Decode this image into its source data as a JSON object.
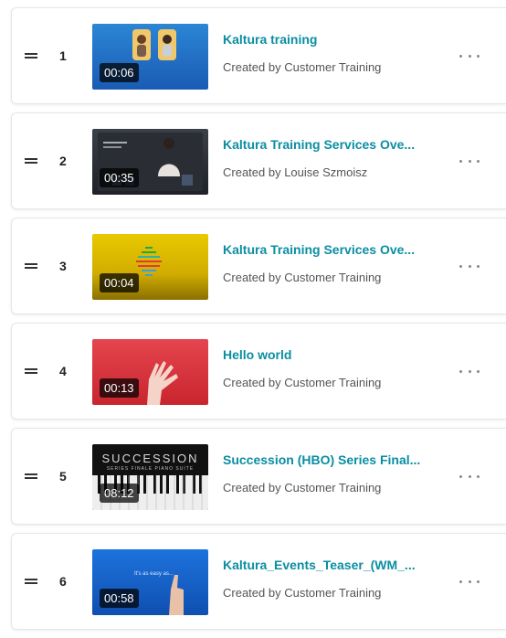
{
  "playlist": {
    "items": [
      {
        "index": "1",
        "duration": "00:06",
        "title": "Kaltura training",
        "creator": "Created by Customer Training"
      },
      {
        "index": "2",
        "duration": "00:35",
        "title": "Kaltura Training Services Ove...",
        "creator": "Created by Louise Szmoisz"
      },
      {
        "index": "3",
        "duration": "00:04",
        "title": "Kaltura Training Services Ove...",
        "creator": "Created by Customer Training"
      },
      {
        "index": "4",
        "duration": "00:13",
        "title": "Hello world",
        "creator": "Created by Customer Training"
      },
      {
        "index": "5",
        "duration": "08:12",
        "title": "Succession (HBO) Series Final...",
        "creator": "Created by Customer Training",
        "thumbnail_text": "SUCCESSION",
        "thumbnail_subtext": "SERIES FINALE PIANO SUITE"
      },
      {
        "index": "6",
        "duration": "00:58",
        "title": "Kaltura_Events_Teaser_(WM_...",
        "creator": "Created by Customer Training",
        "thumbnail_text": "It's as easy as..."
      }
    ]
  },
  "colors": {
    "title": "#0a8ea2",
    "creator": "#555555",
    "border": "#e6e6e6"
  },
  "icons": {
    "drag": "drag-handle-icon",
    "more": "more-options-icon"
  }
}
